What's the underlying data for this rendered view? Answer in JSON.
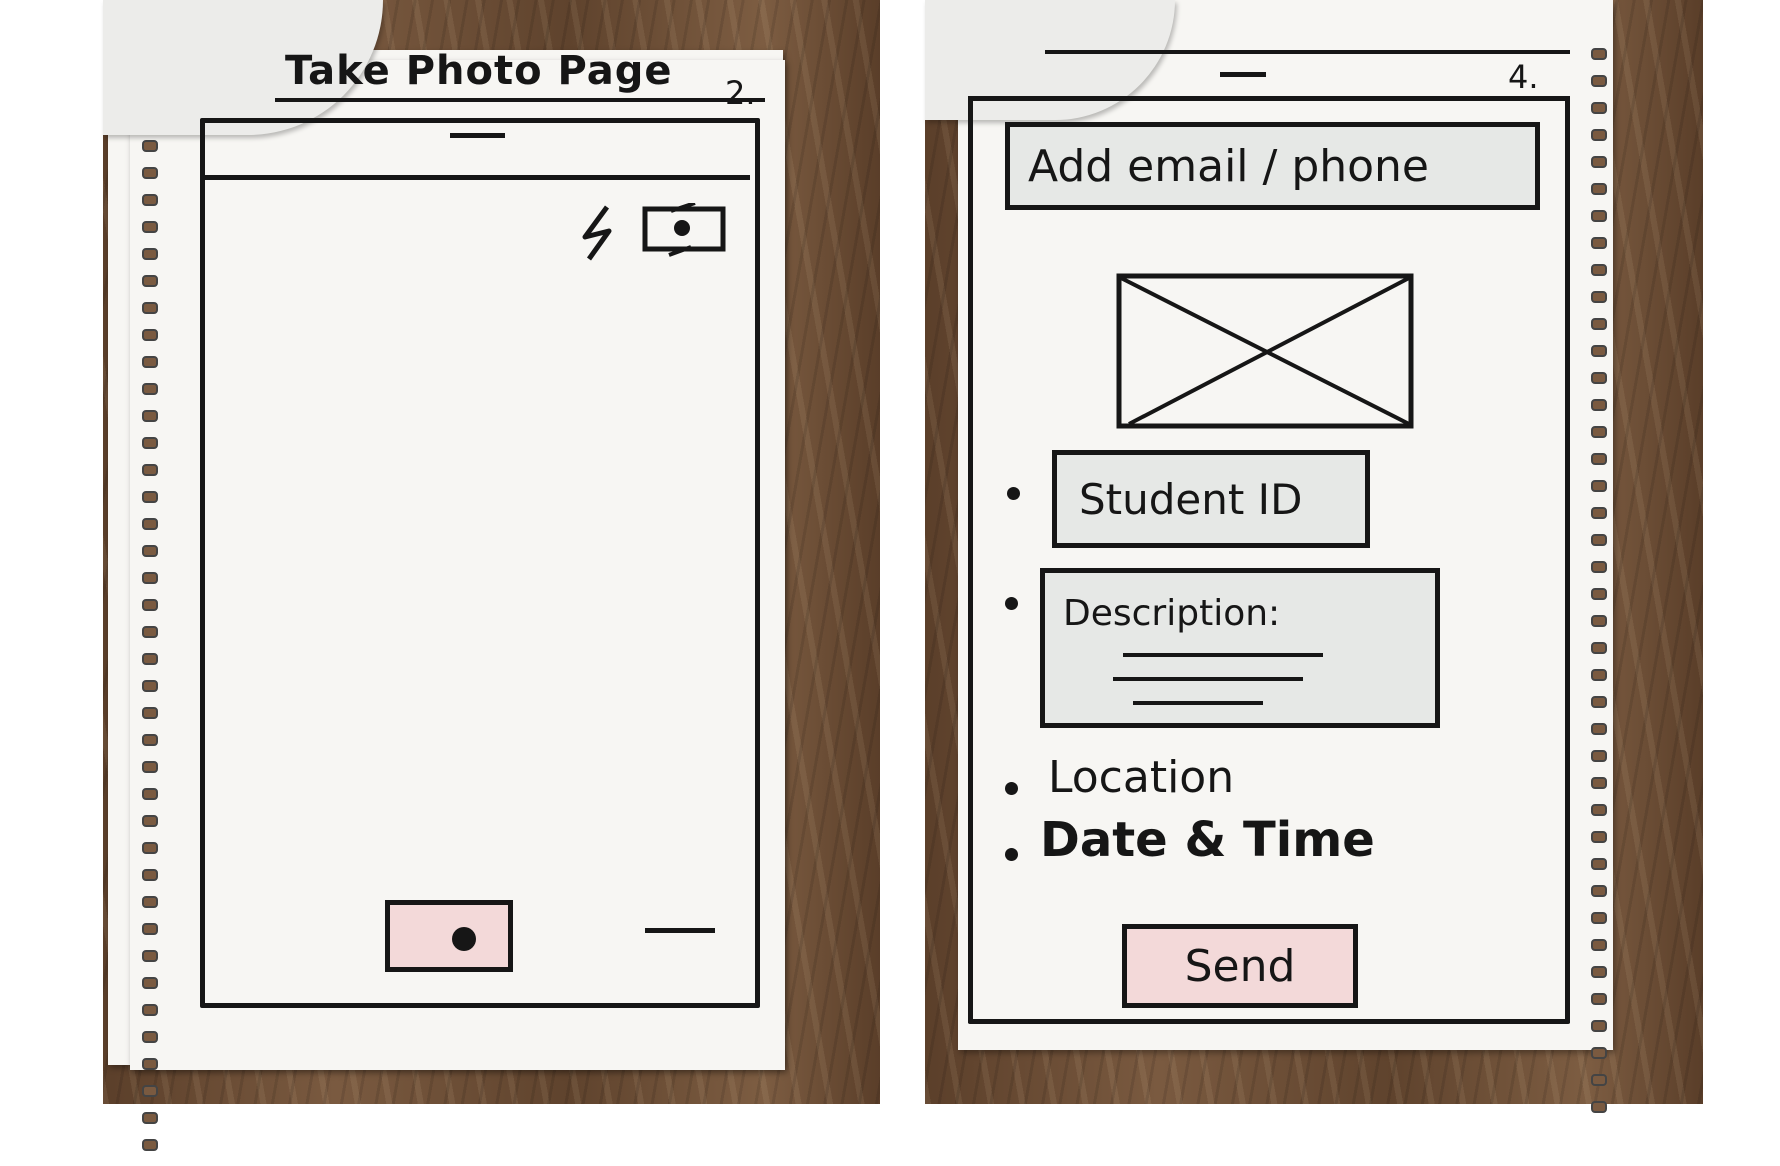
{
  "left_sketch": {
    "title": "Take Photo Page",
    "page_number": "2.",
    "icons": [
      "flash-icon",
      "switch-camera-icon",
      "shutter-icon"
    ]
  },
  "right_sketch": {
    "page_number": "4.",
    "recipient_field": "Add email / phone",
    "image_placeholder_icon": "image-placeholder-icon",
    "student_id_field": "Student ID",
    "description_field": "Description:",
    "location_label": "Location",
    "date_time_label": "Date & Time",
    "send_button": "Send"
  },
  "colors": {
    "ink": "#161616",
    "paper": "#f7f6f3",
    "shaded_field": "#e6e8e6",
    "button_pink": "#f3d9d9"
  }
}
